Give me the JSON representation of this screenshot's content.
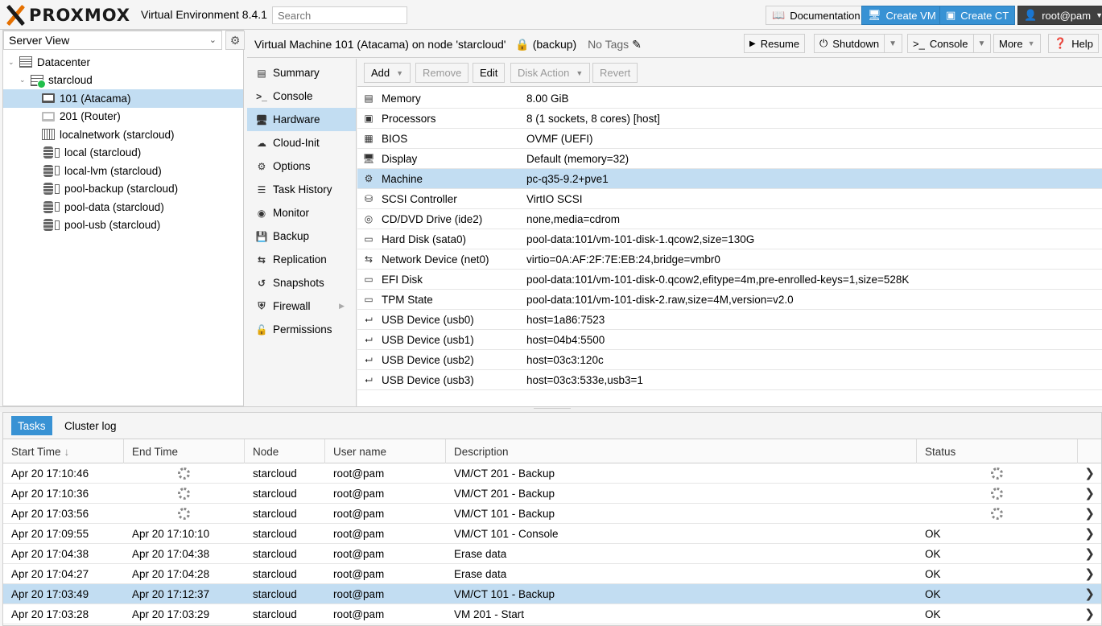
{
  "header": {
    "logo_text": "PROXMOX",
    "version": "Virtual Environment 8.4.1",
    "search_placeholder": "Search",
    "documentation": "Documentation",
    "create_vm": "Create VM",
    "create_ct": "Create CT",
    "user": "root@pam"
  },
  "sidebar": {
    "view": "Server View",
    "tree": [
      {
        "label": "Datacenter",
        "icon": "datacenter-icon"
      },
      {
        "label": "starcloud",
        "icon": "node-icon"
      },
      {
        "label": "101 (Atacama)",
        "icon": "vm-icon"
      },
      {
        "label": "201 (Router)",
        "icon": "vm-icon"
      },
      {
        "label": "localnetwork (starcloud)",
        "icon": "network-icon"
      },
      {
        "label": "local (starcloud)",
        "icon": "storage-icon"
      },
      {
        "label": "local-lvm (starcloud)",
        "icon": "storage-icon"
      },
      {
        "label": "pool-backup (starcloud)",
        "icon": "storage-icon"
      },
      {
        "label": "pool-data (starcloud)",
        "icon": "storage-icon"
      },
      {
        "label": "pool-usb (starcloud)",
        "icon": "storage-icon"
      }
    ]
  },
  "vm": {
    "title": "Virtual Machine 101 (Atacama) on node 'starcloud'",
    "lock": "(backup)",
    "tags": "No Tags",
    "resume": "Resume",
    "shutdown": "Shutdown",
    "console": "Console",
    "more": "More",
    "help": "Help"
  },
  "nav": {
    "items": [
      {
        "label": "Summary",
        "icon": "summary-icon"
      },
      {
        "label": "Console",
        "icon": "terminal-icon"
      },
      {
        "label": "Hardware",
        "icon": "monitor-icon"
      },
      {
        "label": "Cloud-Init",
        "icon": "cloud-icon"
      },
      {
        "label": "Options",
        "icon": "gear-icon"
      },
      {
        "label": "Task History",
        "icon": "list-icon"
      },
      {
        "label": "Monitor",
        "icon": "eye-icon"
      },
      {
        "label": "Backup",
        "icon": "floppy-icon"
      },
      {
        "label": "Replication",
        "icon": "retweet-icon"
      },
      {
        "label": "Snapshots",
        "icon": "history-icon"
      },
      {
        "label": "Firewall",
        "icon": "shield-icon"
      },
      {
        "label": "Permissions",
        "icon": "unlock-icon"
      }
    ]
  },
  "toolbar": {
    "add": "Add",
    "remove": "Remove",
    "edit": "Edit",
    "disk_action": "Disk Action",
    "revert": "Revert"
  },
  "hardware": [
    {
      "name": "Memory",
      "value": "8.00 GiB",
      "icon": "memory-icon"
    },
    {
      "name": "Processors",
      "value": "8 (1 sockets, 8 cores) [host]",
      "icon": "cpu-icon"
    },
    {
      "name": "BIOS",
      "value": "OVMF (UEFI)",
      "icon": "microchip-icon"
    },
    {
      "name": "Display",
      "value": "Default (memory=32)",
      "icon": "desktop-icon"
    },
    {
      "name": "Machine",
      "value": "pc-q35-9.2+pve1",
      "icon": "cogs-icon"
    },
    {
      "name": "SCSI Controller",
      "value": "VirtIO SCSI",
      "icon": "database-icon"
    },
    {
      "name": "CD/DVD Drive (ide2)",
      "value": "none,media=cdrom",
      "icon": "cdrom-icon"
    },
    {
      "name": "Hard Disk (sata0)",
      "value": "pool-data:101/vm-101-disk-1.qcow2,size=130G",
      "icon": "hdd-icon"
    },
    {
      "name": "Network Device (net0)",
      "value": "virtio=0A:AF:2F:7E:EB:24,bridge=vmbr0",
      "icon": "exchange-icon"
    },
    {
      "name": "EFI Disk",
      "value": "pool-data:101/vm-101-disk-0.qcow2,efitype=4m,pre-enrolled-keys=1,size=528K",
      "icon": "hdd-icon"
    },
    {
      "name": "TPM State",
      "value": "pool-data:101/vm-101-disk-2.raw,size=4M,version=v2.0",
      "icon": "hdd-icon"
    },
    {
      "name": "USB Device (usb0)",
      "value": "host=1a86:7523",
      "icon": "usb-icon"
    },
    {
      "name": "USB Device (usb1)",
      "value": "host=04b4:5500",
      "icon": "usb-icon"
    },
    {
      "name": "USB Device (usb2)",
      "value": "host=03c3:120c",
      "icon": "usb-icon"
    },
    {
      "name": "USB Device (usb3)",
      "value": "host=03c3:533e,usb3=1",
      "icon": "usb-icon"
    }
  ],
  "tasks": {
    "tab_tasks": "Tasks",
    "tab_cluster_log": "Cluster log",
    "columns": {
      "start": "Start Time",
      "end": "End Time",
      "node": "Node",
      "user": "User name",
      "desc": "Description",
      "status": "Status"
    },
    "rows": [
      {
        "start": "Apr 20 17:10:46",
        "end": "",
        "node": "starcloud",
        "user": "root@pam",
        "desc": "VM/CT 201 - Backup",
        "status": "",
        "running": true
      },
      {
        "start": "Apr 20 17:10:36",
        "end": "",
        "node": "starcloud",
        "user": "root@pam",
        "desc": "VM/CT 201 - Backup",
        "status": "",
        "running": true
      },
      {
        "start": "Apr 20 17:03:56",
        "end": "",
        "node": "starcloud",
        "user": "root@pam",
        "desc": "VM/CT 101 - Backup",
        "status": "",
        "running": true
      },
      {
        "start": "Apr 20 17:09:55",
        "end": "Apr 20 17:10:10",
        "node": "starcloud",
        "user": "root@pam",
        "desc": "VM/CT 101 - Console",
        "status": "OK",
        "running": false
      },
      {
        "start": "Apr 20 17:04:38",
        "end": "Apr 20 17:04:38",
        "node": "starcloud",
        "user": "root@pam",
        "desc": "Erase data",
        "status": "OK",
        "running": false
      },
      {
        "start": "Apr 20 17:04:27",
        "end": "Apr 20 17:04:28",
        "node": "starcloud",
        "user": "root@pam",
        "desc": "Erase data",
        "status": "OK",
        "running": false
      },
      {
        "start": "Apr 20 17:03:49",
        "end": "Apr 20 17:12:37",
        "node": "starcloud",
        "user": "root@pam",
        "desc": "VM/CT 101 - Backup",
        "status": "OK",
        "running": false
      },
      {
        "start": "Apr 20 17:03:28",
        "end": "Apr 20 17:03:29",
        "node": "starcloud",
        "user": "root@pam",
        "desc": "VM 201 - Start",
        "status": "OK",
        "running": false
      }
    ]
  }
}
